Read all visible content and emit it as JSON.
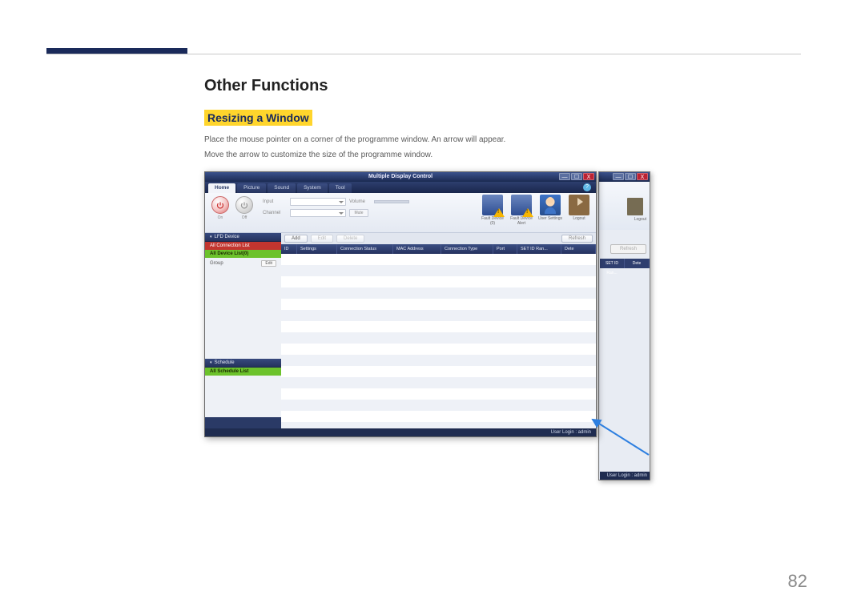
{
  "doc": {
    "heading": "Other Functions",
    "sub": "Resizing a Window",
    "p1": "Place the mouse pointer on a corner of the programme window. An arrow will appear.",
    "p2": "Move the arrow to customize the size of the programme window.",
    "page": "82"
  },
  "app": {
    "title": "Multiple Display Control",
    "win_min": "—",
    "win_max": "☐",
    "win_close": "X",
    "help": "?",
    "tabs": [
      "Home",
      "Picture",
      "Sound",
      "System",
      "Tool"
    ],
    "power": {
      "on": "On",
      "off": "Off"
    },
    "input": {
      "label": "Input",
      "channel": "Channel",
      "volume": "Volume",
      "mute": "Mute"
    },
    "icons": [
      {
        "name": "fault-device",
        "label": "Fault Device (0)"
      },
      {
        "name": "fault-device-alert",
        "label": "Fault Device Alert"
      },
      {
        "name": "user-settings",
        "label": "User Settings"
      },
      {
        "name": "logout",
        "label": "Logout"
      }
    ],
    "sidebar": {
      "lfd": "LFD Device",
      "all_conn": "All Connection List",
      "all_dev": "All Device List(0)",
      "group": "Group",
      "edit": "Edit",
      "schedule": "Schedule",
      "all_sched": "All Schedule List"
    },
    "toolbar": {
      "add": "Add",
      "edit": "Edit",
      "delete": "Delete",
      "refresh": "Refresh"
    },
    "grid": [
      "ID",
      "Settings",
      "Connection Status",
      "MAC Address",
      "Connection Type",
      "Port",
      "SET ID Ran...",
      "Dete"
    ],
    "bg_grid": [
      "SET ID Ran...",
      "Dete"
    ],
    "bg_logout": "Logout",
    "status": "User Login : admin",
    "status_bg": "User Login : admin"
  }
}
